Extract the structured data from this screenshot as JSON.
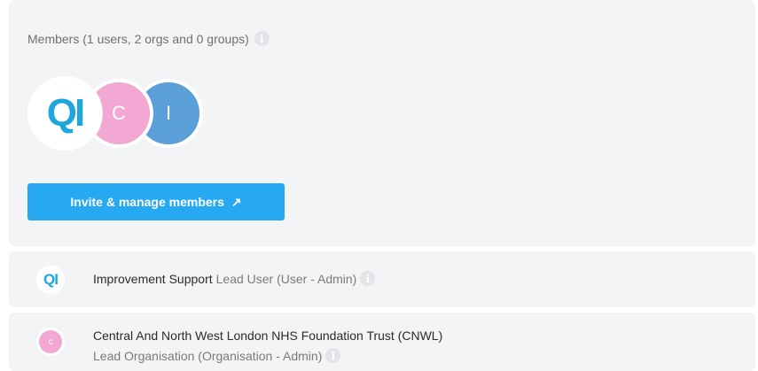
{
  "members": {
    "title": "Members (1 users, 2 orgs and 0 groups)",
    "avatars": [
      {
        "text": "QI",
        "color": "#1ea7dd"
      },
      {
        "text": "C",
        "color": "#f2a8d2"
      },
      {
        "text": "I",
        "color": "#5a9fd8"
      }
    ],
    "invite_label": "Invite & manage members",
    "invite_icon": "external-arrow-icon"
  },
  "list": [
    {
      "avatar": "QI",
      "name": "Improvement Support",
      "role": "Lead User (User - Admin)"
    },
    {
      "avatar": "c",
      "name": "Central And North West London NHS Foundation Trust (CNWL)",
      "role": "Lead Organisation (Organisation - Admin)"
    }
  ],
  "colors": {
    "accent": "#27a9f1",
    "panel": "#f3f4f6"
  }
}
